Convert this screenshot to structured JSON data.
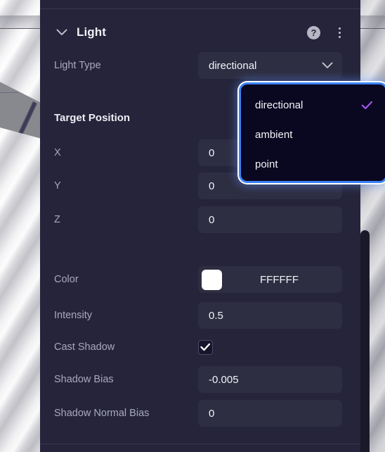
{
  "panel": {
    "title": "Light",
    "collapse_icon": "chevron-down-icon",
    "help_icon_glyph": "?",
    "help_icon": "help-circle-icon",
    "menu_icon": "kebab-menu-icon"
  },
  "fields": {
    "light_type": {
      "label": "Light Type",
      "value": "directional",
      "chevron": "chevron-down-icon"
    },
    "target_position": {
      "label": "Target Position",
      "axes": [
        {
          "label": "X",
          "value": "0"
        },
        {
          "label": "Y",
          "value": "0"
        },
        {
          "label": "Z",
          "value": "0"
        }
      ]
    },
    "color": {
      "label": "Color",
      "hex": "FFFFFF",
      "swatch_color": "#FFFFFF"
    },
    "intensity": {
      "label": "Intensity",
      "value": "0.5"
    },
    "cast_shadow": {
      "label": "Cast Shadow",
      "checked": true,
      "check_glyph": "check-icon"
    },
    "shadow_bias": {
      "label": "Shadow Bias",
      "value": "-0.005"
    },
    "shadow_normal_bias": {
      "label": "Shadow Normal Bias",
      "value": "0"
    }
  },
  "dropdown": {
    "open": true,
    "selected": "directional",
    "options": [
      {
        "label": "directional",
        "selected": true
      },
      {
        "label": "ambient",
        "selected": false
      },
      {
        "label": "point",
        "selected": false
      }
    ],
    "check_color": "#a855f7",
    "border_color": "#3b82f6"
  },
  "colors": {
    "panel_bg": "#25243a",
    "field_bg": "#2e2e42",
    "dropdown_bg": "#0a0720",
    "label_text": "#a9a9bd",
    "value_text": "#f2f2f8",
    "accent_purple": "#a855f7",
    "accent_blue": "#3b82f6"
  }
}
